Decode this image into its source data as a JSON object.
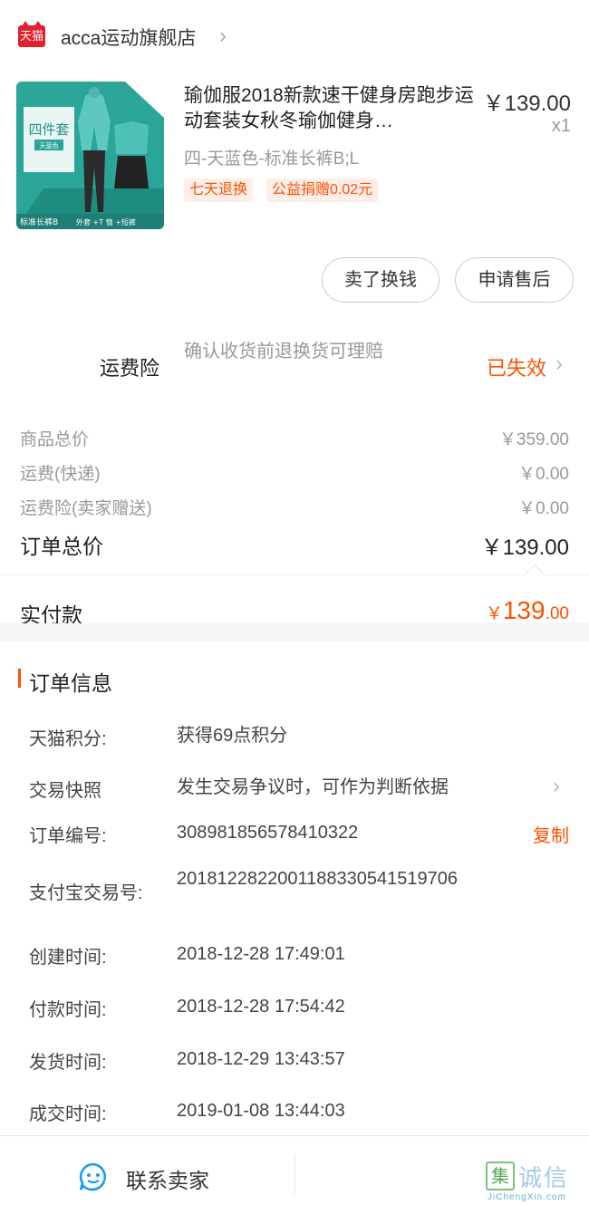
{
  "shop": {
    "badge_label": "天猫",
    "name": "acca运动旗舰店",
    "chevron": "›"
  },
  "product": {
    "image": {
      "badge_text": "四件套",
      "color_tag": "天蓝色",
      "bottom_left": "标准长裤B",
      "bottom_right": "外套 +T 恤 +短裤"
    },
    "title": "瑜伽服2018新款速干健身房跑步运动套装女秋冬瑜伽健身…",
    "price": "￥139.00",
    "quantity": "x1",
    "spec": "四-天蓝色-标准长裤B;L",
    "tags": [
      "七天退换",
      "公益捐赠0.02元"
    ]
  },
  "actions": {
    "sell_label": "卖了换钱",
    "after_sale_label": "申请售后"
  },
  "shipping_insurance": {
    "label": "运费险",
    "description": "确认收货前退换货可理赔",
    "status": "已失效",
    "chevron": "›"
  },
  "summary": {
    "items_total_label": "商品总价",
    "items_total_value": "￥359.00",
    "shipping_label": "运费(快递)",
    "shipping_value": "￥0.00",
    "insurance_label": "运费险(卖家赠送)",
    "insurance_value": "￥0.00",
    "order_total_label": "订单总价",
    "order_total_value": "￥139.00",
    "paid_label": "实付款",
    "paid_currency": "￥",
    "paid_integer": "139",
    "paid_decimal": ".00"
  },
  "order_info": {
    "section_title": "订单信息",
    "points_label": "天猫积分:",
    "points_value": "获得69点积分",
    "snapshot_label": "交易快照",
    "snapshot_value": "发生交易争议时，可作为判断依据",
    "order_no_label": "订单编号:",
    "order_no_value": "308981856578410322",
    "copy_label": "复制",
    "alipay_label": "支付宝交易号:",
    "alipay_value": "2018122822001188330541519706",
    "created_label": "创建时间:",
    "created_value": "2018-12-28 17:49:01",
    "paid_time_label": "付款时间:",
    "paid_time_value": "2018-12-28 17:54:42",
    "shipped_label": "发货时间:",
    "shipped_value": "2018-12-29 13:43:57",
    "completed_label": "成交时间:",
    "completed_value": "2019-01-08 13:44:03"
  },
  "footer": {
    "contact_label": "联系卖家"
  },
  "watermark": {
    "box_char": "集",
    "text": "诚信",
    "sub": "JiChengXin.com"
  },
  "colors": {
    "accent": "#ff5000",
    "tmall_red": "#e3202c",
    "text_primary": "#222222",
    "text_secondary": "#999999",
    "divider": "#e6e6e6",
    "band": "#f5f3f5"
  }
}
